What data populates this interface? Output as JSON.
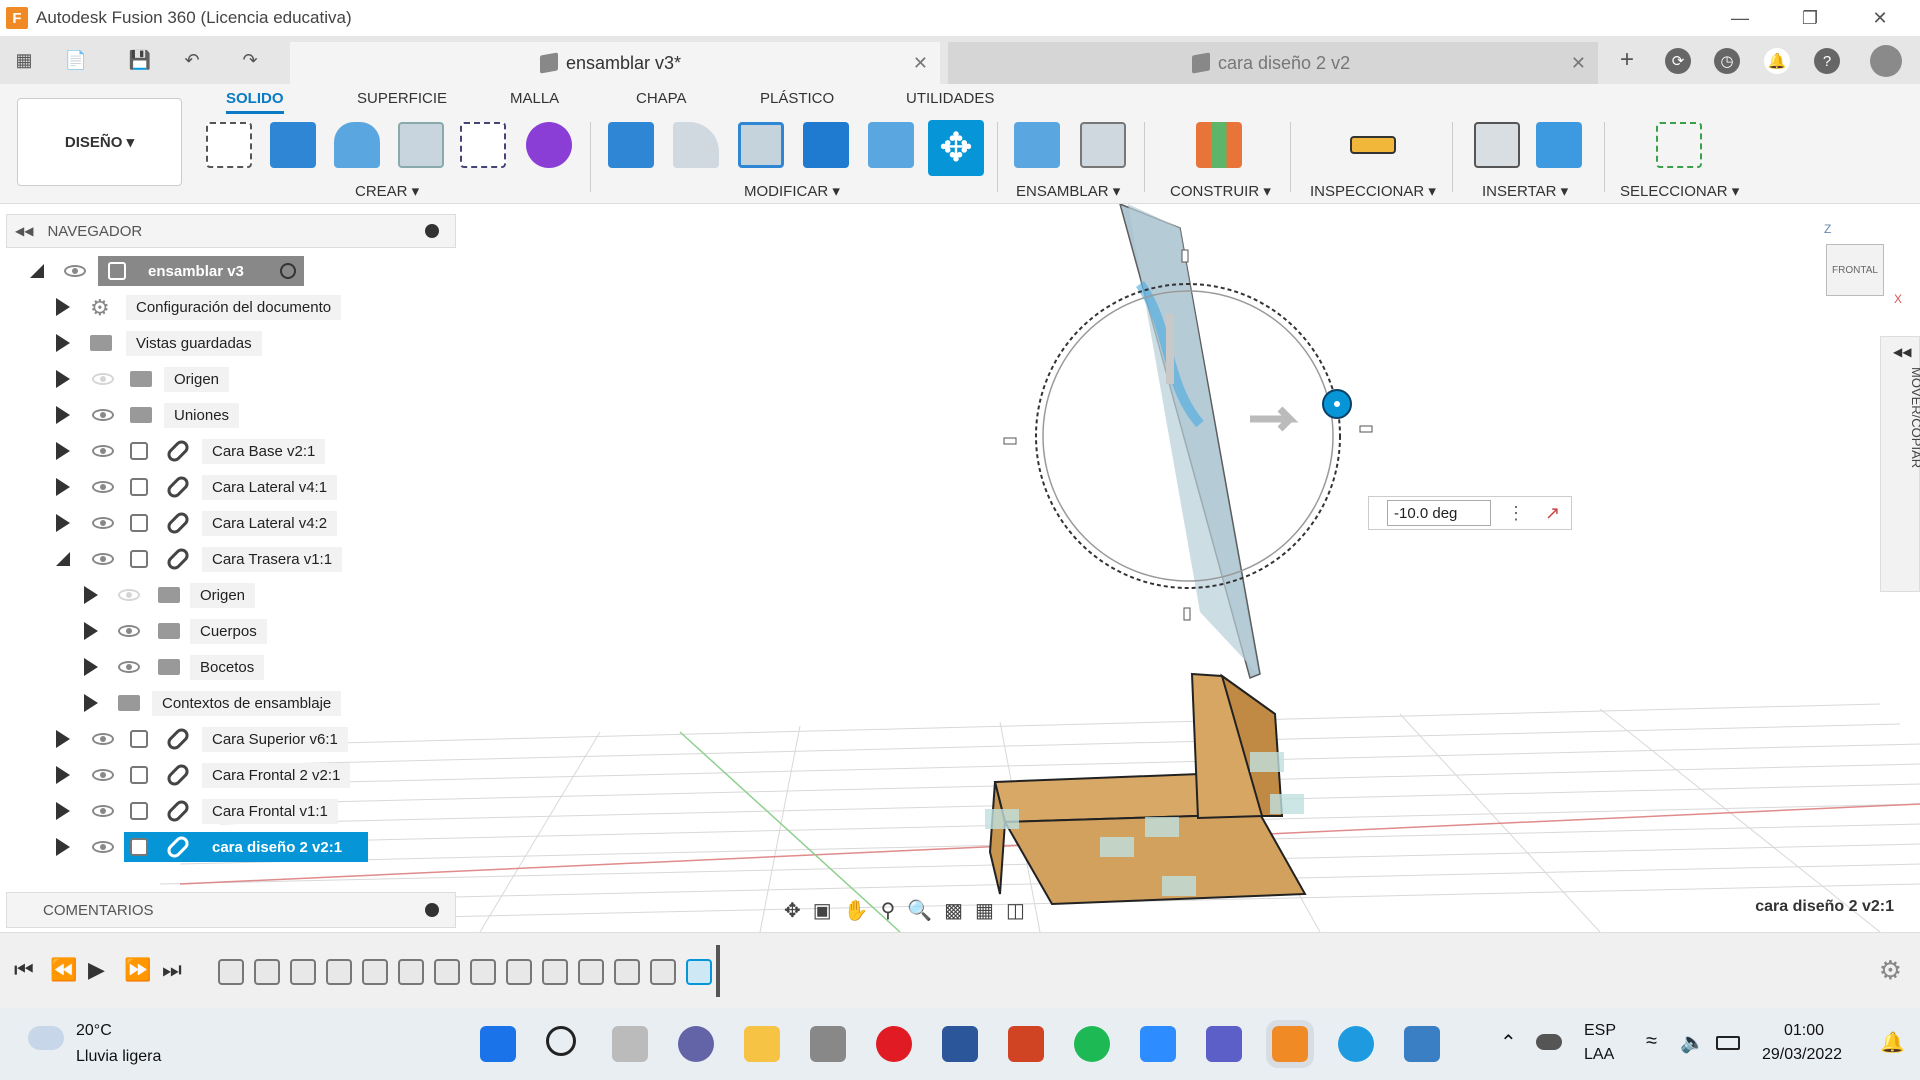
{
  "window": {
    "title": "Autodesk Fusion 360 (Licencia educativa)",
    "logo_letter": "F"
  },
  "doc_tabs": [
    {
      "label": "ensamblar v3*",
      "active": true
    },
    {
      "label": "cara diseño 2 v2",
      "active": false
    }
  ],
  "ribbon": {
    "workspace": "DISEÑO ▾",
    "tabs": [
      "SOLIDO",
      "SUPERFICIE",
      "MALLA",
      "CHAPA",
      "PLÁSTICO",
      "UTILIDADES"
    ],
    "groups": [
      "CREAR ▾",
      "MODIFICAR ▾",
      "ENSAMBLAR ▾",
      "CONSTRUIR ▾",
      "INSPECCIONAR ▾",
      "INSERTAR ▾",
      "SELECCIONAR ▾"
    ]
  },
  "navigator": {
    "title": "NAVEGADOR",
    "root": "ensamblar v3",
    "items": [
      {
        "label": "Configuración del documento",
        "icon": "gear-icon"
      },
      {
        "label": "Vistas guardadas",
        "icon": "folder-icon"
      },
      {
        "label": "Origen",
        "icon": "folder-icon",
        "eye": "hidden"
      },
      {
        "label": "Uniones",
        "icon": "folder-icon",
        "eye": "visible"
      },
      {
        "label": "Cara Base v2:1",
        "icon": "component-icon",
        "eye": "visible"
      },
      {
        "label": "Cara Lateral v4:1",
        "icon": "component-icon",
        "eye": "visible"
      },
      {
        "label": "Cara Lateral v4:2",
        "icon": "component-icon",
        "eye": "visible"
      },
      {
        "label": "Cara Trasera v1:1",
        "icon": "component-icon",
        "eye": "visible",
        "expanded": true
      },
      {
        "label": "Origen",
        "icon": "folder-icon",
        "eye": "hidden",
        "indent": 1
      },
      {
        "label": "Cuerpos",
        "icon": "folder-icon",
        "eye": "visible",
        "indent": 1
      },
      {
        "label": "Bocetos",
        "icon": "folder-icon",
        "eye": "visible",
        "indent": 1
      },
      {
        "label": "Contextos de ensamblaje",
        "icon": "folder-icon",
        "indent": 1
      },
      {
        "label": "Cara Superior v6:1",
        "icon": "component-icon",
        "eye": "visible"
      },
      {
        "label": "Cara Frontal 2 v2:1",
        "icon": "component-icon",
        "eye": "visible"
      },
      {
        "label": "Cara Frontal v1:1",
        "icon": "component-icon",
        "eye": "visible"
      },
      {
        "label": "cara diseño 2 v2:1",
        "icon": "component-icon",
        "eye": "visible",
        "selected": true
      }
    ]
  },
  "comments": {
    "title": "COMENTARIOS"
  },
  "viewport": {
    "angle_input": "-10.0 deg",
    "viewcube_label": "FRONTAL",
    "axis_z": "Z",
    "axis_x": "X",
    "side_panel": "MOVER/COPIAR",
    "selection_name": "cara diseño 2 v2:1"
  },
  "taskbar": {
    "weather_temp": "20°C",
    "weather_desc": "Lluvia ligera",
    "lang1": "ESP",
    "lang2": "LAA",
    "time": "01:00",
    "date": "29/03/2022"
  },
  "colors": {
    "accent": "#0696d7",
    "wood": "#d2a15e",
    "panel_glass": "#a9c3cf"
  }
}
